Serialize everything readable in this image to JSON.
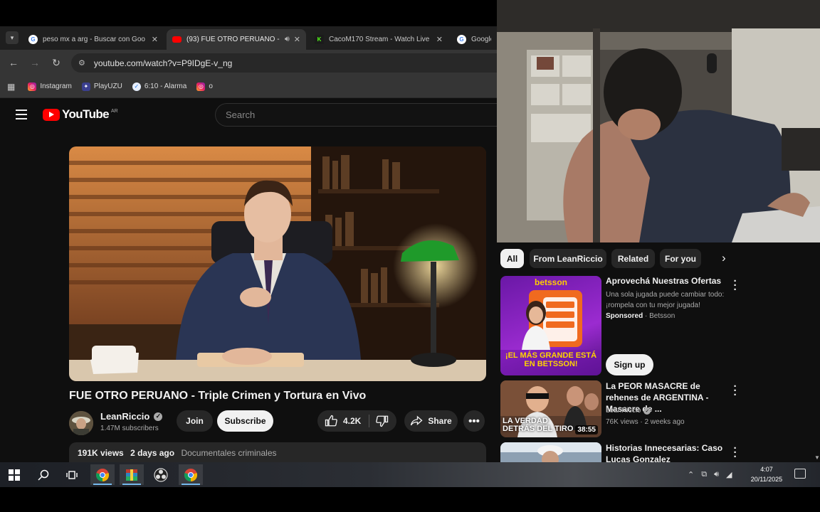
{
  "browser": {
    "tabs": [
      {
        "title": "peso mx a arg - Buscar con Goo",
        "favicon": "google-icon",
        "active": false
      },
      {
        "title": "(93) FUE OTRO PERUANO -",
        "favicon": "youtube-icon",
        "active": true
      },
      {
        "title": "CacoM170 Stream - Watch Live",
        "favicon": "kick-icon",
        "active": false
      },
      {
        "title": "Google",
        "favicon": "google-icon",
        "active": false
      }
    ],
    "url": "youtube.com/watch?v=P9IDgE-v_ng",
    "bookmarks": [
      {
        "label": "Instagram",
        "icon": "instagram-icon"
      },
      {
        "label": "PlayUZU",
        "icon": "playuzu-icon"
      },
      {
        "label": "6:10 - Alarma",
        "icon": "alarm-icon"
      },
      {
        "label": "o",
        "icon": "instagram-icon"
      }
    ]
  },
  "youtube": {
    "logo_text": "YouTube",
    "country_code": "AR",
    "search_placeholder": "Search",
    "video": {
      "title": "FUE OTRO PERUANO - Triple Crimen y Tortura en Vivo",
      "channel": "LeanRiccio",
      "subscribers": "1.47M subscribers",
      "join_label": "Join",
      "subscribe_label": "Subscribe",
      "likes": "4.2K",
      "share_label": "Share",
      "views": "191K views",
      "posted": "2 days ago",
      "category": "Documentales criminales"
    },
    "chips": [
      "All",
      "From LeanRiccio",
      "Related",
      "For you"
    ],
    "ad": {
      "brand": "betsson",
      "banner_text": "¡EL MÁS GRANDE ESTÁ EN BETSSON!",
      "title": "Aprovechá Nuestras Ofertas",
      "description": "Una sola jugada puede cambiar todo: ¡rompela con tu mejor jugada!",
      "sponsored_label": "Sponsored",
      "advertiser": "Betsson",
      "cta": "Sign up"
    },
    "recommendations": [
      {
        "title": "La PEOR MASACRE de rehenes de ARGENTINA - Masacre de ...",
        "channel": "LeanRiccio",
        "meta": "76K views · 2 weeks ago",
        "duration": "38:55",
        "thumb_text": "LA VERDAD DETRÁS DEL TIRO"
      },
      {
        "title": "Historias Innecesarias: Caso Lucas Gonzalez",
        "channel": "",
        "meta": "",
        "duration": "",
        "thumb_text": ""
      }
    ]
  },
  "taskbar": {
    "time": "4:07",
    "date": "20/11/2025"
  },
  "colors": {
    "youtube_red": "#ff0000",
    "page_bg": "#0f0f0f",
    "chip_bg": "#272727",
    "ad_purple": "#7a1fb0"
  }
}
